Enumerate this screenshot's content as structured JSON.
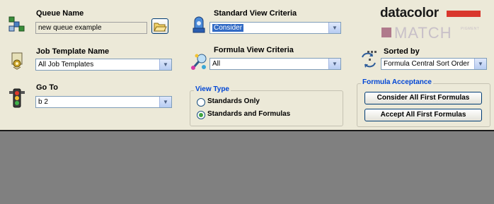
{
  "queue": {
    "label": "Queue Name",
    "value": "new queue example"
  },
  "job_template": {
    "label": "Job Template Name",
    "value": "All Job Templates"
  },
  "goto": {
    "label": "Go To",
    "value": "b 2"
  },
  "standard_view": {
    "label": "Standard View Criteria",
    "value": "Consider"
  },
  "formula_view": {
    "label": "Formula View Criteria",
    "value": "All"
  },
  "view_type": {
    "title": "View Type",
    "options": [
      "Standards Only",
      "Standards and Formulas"
    ],
    "selected": "Standards and Formulas"
  },
  "brand": {
    "name": "datacolor",
    "product": "MATCH",
    "sub": "PIGMENT",
    "accent": "#d9372d"
  },
  "sorted_by": {
    "label": "Sorted by",
    "value": "Formula Central Sort Order"
  },
  "formula_acceptance": {
    "title": "Formula Acceptance",
    "consider_label": "Consider All First Formulas",
    "accept_label": "Accept All First Formulas"
  }
}
